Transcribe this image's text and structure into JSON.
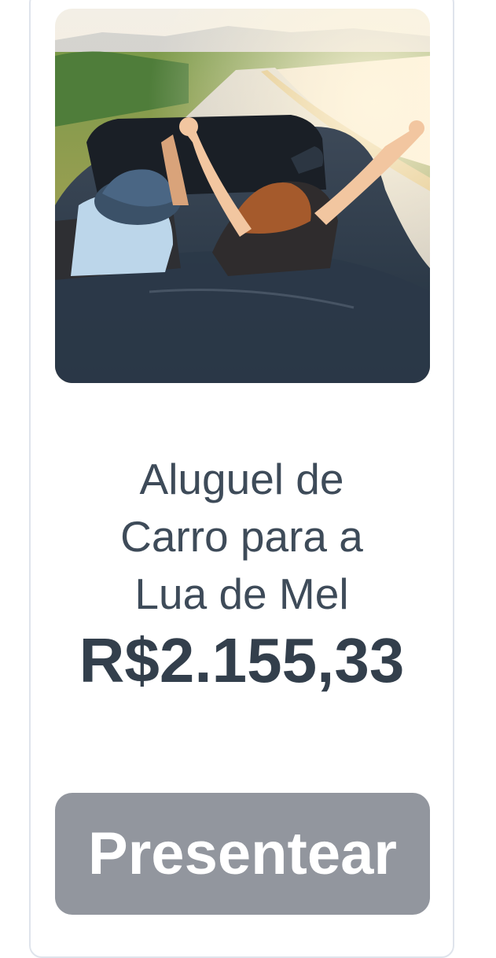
{
  "product": {
    "image": {
      "icon": "convertible-car-couple-photo",
      "description": "Couple in a convertible car on a country road"
    },
    "title_lines": [
      "Aluguel de",
      "Carro para a",
      "Lua de Mel"
    ],
    "price": "R$2.155,33",
    "gift_button_label": "Presentear"
  },
  "colors": {
    "title": "#3e4b59",
    "price": "#333f4c",
    "button_bg": "#92969e",
    "button_text": "#ffffff",
    "card_border": "#dfe4ec"
  }
}
